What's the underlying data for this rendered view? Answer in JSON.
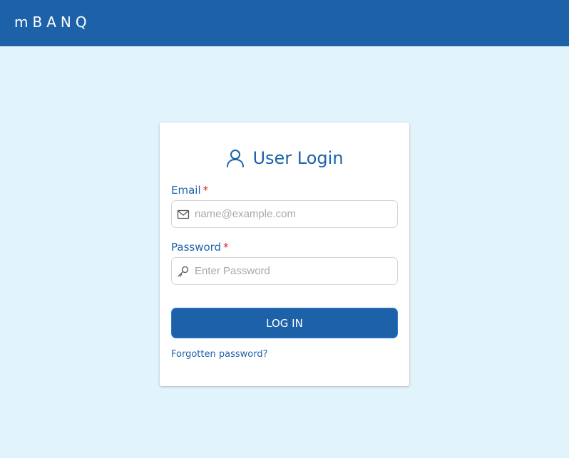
{
  "header": {
    "brand": "mBANQ"
  },
  "login": {
    "title": "User Login",
    "email": {
      "label": "Email",
      "required_mark": "*",
      "placeholder": "name@example.com",
      "value": ""
    },
    "password": {
      "label": "Password",
      "required_mark": "*",
      "placeholder": "Enter Password",
      "value": ""
    },
    "submit_label": "LOG IN",
    "forgot_link": "Forgotten password?"
  },
  "icons": {
    "title": "user-icon",
    "email": "envelope-icon",
    "password": "key-icon"
  },
  "colors": {
    "brand": "#1d62a8",
    "background": "#e1f3fb",
    "required": "#e0202a"
  }
}
